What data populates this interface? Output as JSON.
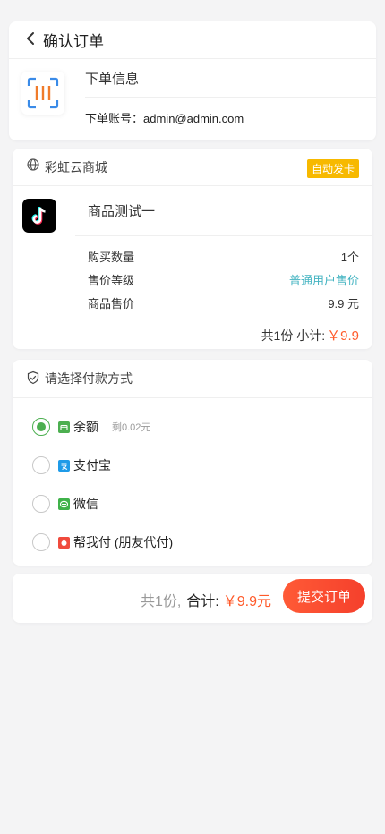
{
  "header": {
    "title": "确认订单"
  },
  "order_info": {
    "section_title": "下单信息",
    "account_label": "下单账号：",
    "account_value": "admin@admin.com"
  },
  "shop": {
    "name": "彩虹云商城",
    "badge": "自动发卡",
    "badge_color": "#f7b900"
  },
  "product": {
    "name": "商品测试一",
    "rows": [
      {
        "label": "购买数量",
        "value": "1个"
      },
      {
        "label": "售价等级",
        "value": "普通用户售价"
      },
      {
        "label": "商品售价",
        "value": "9.9 元"
      }
    ],
    "subtotal_label": "共1份 小计:",
    "subtotal_value": "￥9.9"
  },
  "payment": {
    "title": "请选择付款方式",
    "selected": "余额",
    "options": [
      {
        "label": "余额",
        "note": "剩0.02元",
        "icon": "wallet-icon",
        "icon_color": "#4caf50"
      },
      {
        "label": "支付宝",
        "note": "",
        "icon": "alipay-icon",
        "icon_color": "#1e9be8"
      },
      {
        "label": "微信",
        "note": "",
        "icon": "wechat-icon",
        "icon_color": "#3fb24a"
      },
      {
        "label": "帮我付 (朋友代付)",
        "note": "",
        "icon": "friend-pay-icon",
        "icon_color": "#f04a3c"
      }
    ]
  },
  "footer": {
    "qty_text": "共1份,",
    "total_label": "合计:",
    "total_value": "￥9.9元",
    "submit_label": "提交订单"
  },
  "colors": {
    "accent": "#ff5a2a",
    "link": "#45b4c2",
    "selected_radio": "#4caf50"
  }
}
